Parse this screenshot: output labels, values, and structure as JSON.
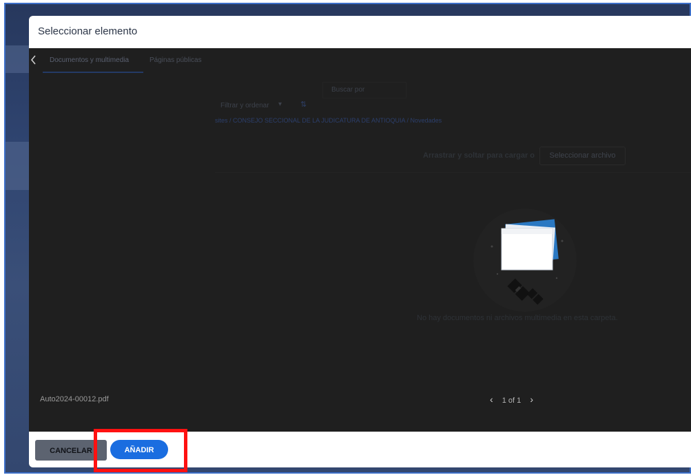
{
  "modal": {
    "title": "Seleccionar elemento"
  },
  "tabs": [
    {
      "label": "Documentos y multimedia",
      "active": true
    },
    {
      "label": "Páginas públicas",
      "active": false
    }
  ],
  "toolbar": {
    "filter_label": "Filtrar y ordenar",
    "search_placeholder": "Buscar por"
  },
  "breadcrumb": "sites  /  CONSEJO SECCIONAL DE LA JUDICATURA DE ANTIOQUIA  /  Novedades",
  "upload": {
    "drop_label": "Arrastrar y soltar para cargar o",
    "select_file_label": "Seleccionar archivo"
  },
  "empty_state": {
    "message": "No hay documentos ni archivos multimedia en esta carpeta."
  },
  "selected_file": "Auto2024-00012.pdf",
  "pagination": {
    "label": "1 of 1"
  },
  "footer": {
    "cancel_label": "CANCELAR",
    "add_label": "AÑADIR"
  },
  "colors": {
    "accent": "#1a6de0",
    "highlight": "#ff1111",
    "cancel_bg": "#5c6370"
  }
}
